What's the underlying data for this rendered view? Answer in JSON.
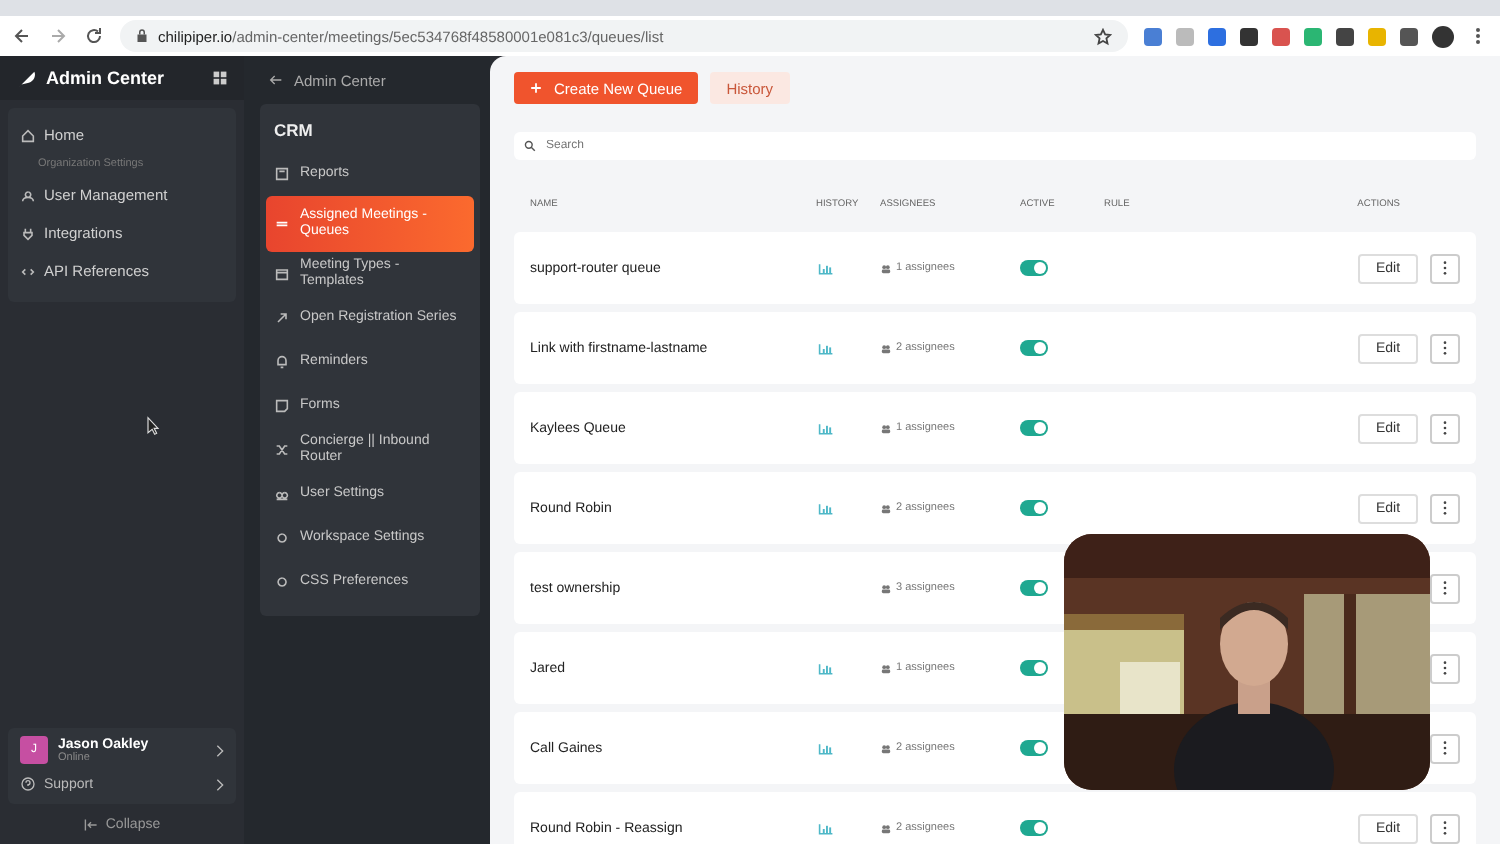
{
  "browser": {
    "url_host": "chilipiper.io",
    "url_path": "/admin-center/meetings/5ec534768f48580001e081c3/queues/list"
  },
  "sidebar": {
    "title": "Admin Center",
    "items": [
      {
        "kind": "link",
        "label": "Home",
        "selected": false
      },
      {
        "kind": "caption",
        "label": "Organization Settings"
      },
      {
        "kind": "link",
        "label": "User Management",
        "selected": false
      },
      {
        "kind": "link",
        "label": "Integrations",
        "selected": false
      },
      {
        "kind": "link",
        "label": "API References",
        "selected": false
      }
    ]
  },
  "user": {
    "initial": "J",
    "name": "Jason Oakley",
    "status": "Online"
  },
  "support": "Support",
  "collapse": "Collapse",
  "subnav": {
    "back": "Admin Center",
    "heading": "CRM",
    "items": [
      {
        "label": "Reports",
        "selected": false
      },
      {
        "label": "Assigned Meetings - Queues",
        "selected": true
      },
      {
        "label": "Meeting Types - Templates",
        "selected": false
      },
      {
        "label": "Open Registration Series",
        "selected": false
      },
      {
        "label": "Reminders",
        "selected": false
      },
      {
        "label": "Forms",
        "selected": false
      },
      {
        "label": "Concierge || Inbound Router",
        "selected": false
      },
      {
        "label": "User Settings",
        "selected": false
      },
      {
        "label": "Workspace Settings",
        "selected": false
      },
      {
        "label": "CSS Preferences",
        "selected": false
      }
    ]
  },
  "toolbar": {
    "primary": "Create New Queue",
    "secondary": "History"
  },
  "search": {
    "placeholder": "Search"
  },
  "table": {
    "columns": [
      "NAME",
      "HISTORY",
      "ASSIGNEES",
      "ACTIVE",
      "RULE",
      "ACTIONS"
    ],
    "rows": [
      {
        "name": "support-router queue",
        "history": true,
        "assignees": "1 assignees",
        "active": true,
        "edit": "Edit"
      },
      {
        "name": "Link with firstname-lastname",
        "history": true,
        "assignees": "2 assignees",
        "active": true,
        "edit": "Edit"
      },
      {
        "name": "Kaylees Queue",
        "history": true,
        "assignees": "1 assignees",
        "active": true,
        "edit": "Edit"
      },
      {
        "name": "Round Robin",
        "history": true,
        "assignees": "2 assignees",
        "active": true,
        "edit": "Edit"
      },
      {
        "name": "test ownership",
        "history": false,
        "assignees": "3 assignees",
        "active": true
      },
      {
        "name": "Jared",
        "history": true,
        "assignees": "1 assignees",
        "active": true
      },
      {
        "name": "Call Gaines",
        "history": true,
        "assignees": "2 assignees",
        "active": true
      },
      {
        "name": "Round Robin - Reassign",
        "history": true,
        "assignees": "2 assignees",
        "active": true,
        "edit": "Edit"
      }
    ]
  }
}
